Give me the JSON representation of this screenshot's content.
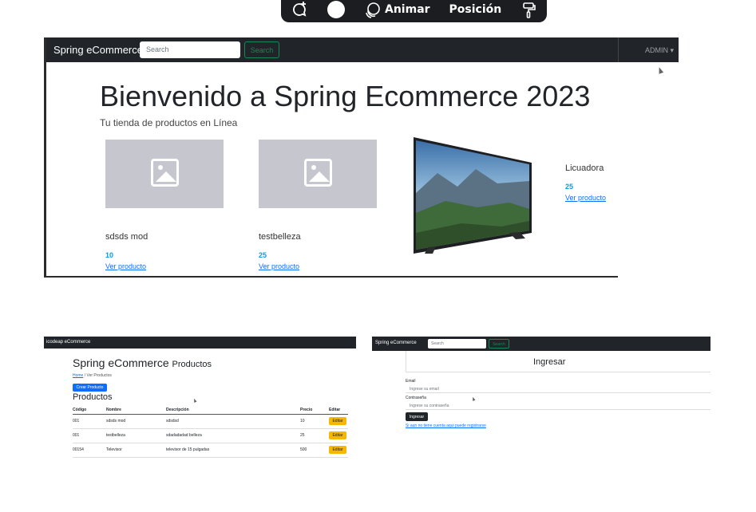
{
  "toolbar": {
    "items": [
      {
        "icon": "comment-add-icon"
      },
      {
        "icon": "color-circle-icon"
      },
      {
        "icon": "animate-icon",
        "label": "Animar"
      },
      {
        "label": "Posición"
      },
      {
        "icon": "paint-roller-icon"
      }
    ]
  },
  "main_page": {
    "brand": "Spring eCommerce",
    "search_placeholder": "Search",
    "search_button": "Search",
    "admin_menu": "ADMIN",
    "welcome_title": "Bienvenido a Spring Ecommerce 2023",
    "tagline": "Tu tienda de productos en Línea",
    "products": [
      {
        "name": "sdsds mod",
        "price": "10",
        "link": "Ver producto"
      },
      {
        "name": "testbelleza",
        "price": "25",
        "link": "Ver producto"
      },
      {
        "name": "Licuadora",
        "price": "25",
        "link": "Ver producto"
      }
    ]
  },
  "products_page": {
    "brand": "icodeap eCommerce",
    "title": "Spring eCommerce",
    "title_suffix": "Productos",
    "breadcrumb_home": "Home",
    "breadcrumb_current": "/ Ver Productos",
    "create_button": "Crear Producto",
    "section_title": "Productos",
    "columns": [
      "Código",
      "Nombre",
      "Descripción",
      "Precio",
      "Editar"
    ],
    "rows": [
      {
        "code": "001",
        "name": "sdsds mod",
        "description": "sdsdsd",
        "price": "10",
        "action": "Editar"
      },
      {
        "code": "001",
        "name": "testbelleza",
        "description": "sdadadadad belleza",
        "price": "25",
        "action": "Editar"
      },
      {
        "code": "00154",
        "name": "Televisor",
        "description": "televisor de 15 pulgadas",
        "price": "500",
        "action": "Editar"
      }
    ]
  },
  "login_page": {
    "brand": "Spring eCommerce",
    "search_placeholder": "Search",
    "search_button": "Search",
    "title": "Ingresar",
    "email_label": "Email",
    "email_placeholder": "Ingrese su email",
    "password_label": "Contraseña",
    "password_placeholder": "Ingrese su contraseña",
    "submit_button": "Ingresar",
    "register_link": "Si aun no tiene cuenta aqui puede registrarse"
  },
  "colors": {
    "navbar": "#212529",
    "primary": "#0d6efd",
    "price": "#0d9bd8",
    "warning": "#f5b700",
    "placeholder_image": "#c5c6ce"
  }
}
